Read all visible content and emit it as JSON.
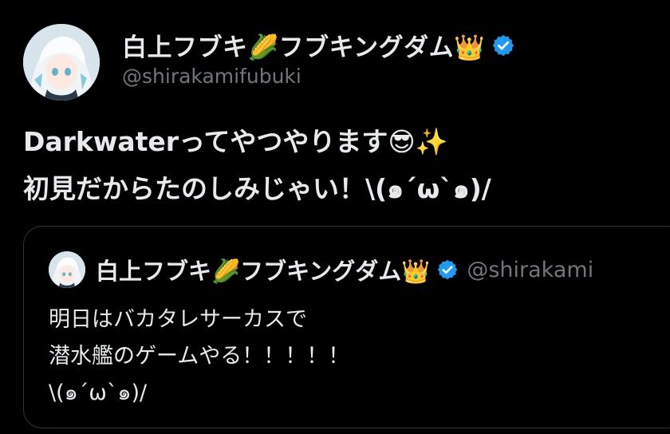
{
  "author": {
    "display_name": "白上フブキ🌽フブキングダム👑",
    "handle": "@shirakamifubuki",
    "verified_icon": "verified-badge-icon",
    "verified_color": "#1d9bf0"
  },
  "tweet": {
    "lines": [
      "Darkwaterってやつやります😎✨",
      "初見だからたのしみじゃい！\\(๑´ω`๑)/"
    ]
  },
  "quoted_tweet": {
    "display_name": "白上フブキ🌽フブキングダム👑",
    "handle": "@shirakami",
    "lines": [
      "明日はバカタレサーカスで",
      "潜水艦のゲームやる！！！！！",
      "\\(๑´ω`๑)/"
    ]
  },
  "colors": {
    "background": "#000000",
    "text_primary": "#e7e9ea",
    "text_secondary": "#71767b",
    "border": "#2f3336"
  }
}
